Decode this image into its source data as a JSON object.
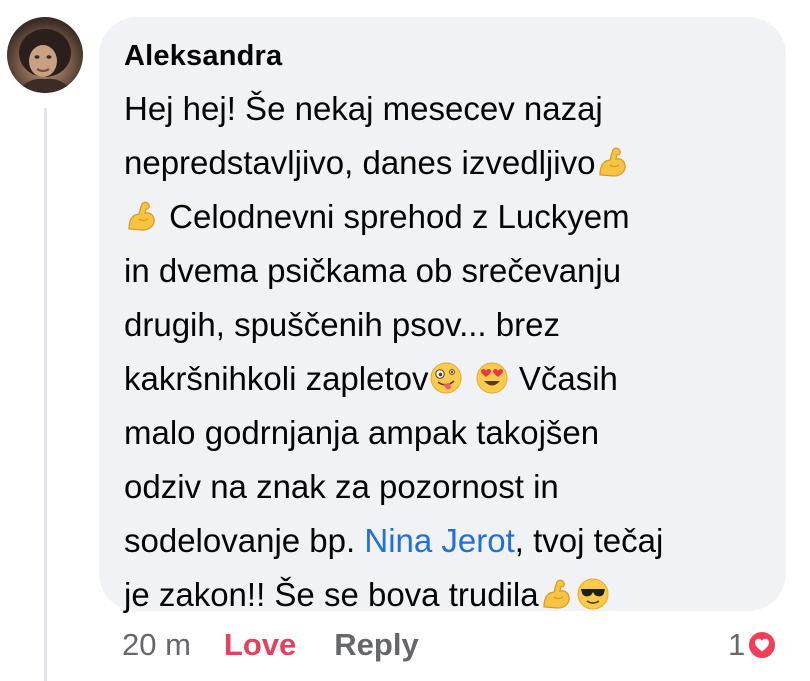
{
  "comment": {
    "author": "Aleksandra",
    "lines": [
      {
        "parts": [
          {
            "t": "Hej hej! Še nekaj mesecev nazaj"
          }
        ]
      },
      {
        "parts": [
          {
            "t": "nepredstavljivo, danes izvedljivo"
          },
          {
            "e": "flexed-biceps-icon"
          }
        ]
      },
      {
        "parts": [
          {
            "e": "flexed-biceps-icon"
          },
          {
            "t": " Celodnevni sprehod z Luckyem"
          }
        ]
      },
      {
        "parts": [
          {
            "t": "in dvema psičkama ob srečevanju"
          }
        ]
      },
      {
        "parts": [
          {
            "t": "drugih, spuščenih psov... brez"
          }
        ]
      },
      {
        "parts": [
          {
            "t": "kakršnihkoli zapletov"
          },
          {
            "e": "zany-face-icon"
          },
          {
            "t": " "
          },
          {
            "e": "heart-eyes-face-icon"
          },
          {
            "t": " Včasih"
          }
        ]
      },
      {
        "parts": [
          {
            "t": "malo godrnjanja ampak takojšen"
          }
        ]
      },
      {
        "parts": [
          {
            "t": "odziv na znak za pozornost in"
          }
        ]
      },
      {
        "parts": [
          {
            "t": "sodelovanje bp. "
          },
          {
            "m": "Nina Jerot"
          },
          {
            "t": ", tvoj tečaj"
          }
        ]
      },
      {
        "parts": [
          {
            "t": "je zakon!! Še se bova trudila"
          },
          {
            "e": "flexed-biceps-icon"
          },
          {
            "e": "sunglasses-face-icon"
          }
        ]
      }
    ]
  },
  "actions": {
    "time": "20 m",
    "love": "Love",
    "reply": "Reply"
  },
  "reactions": {
    "count": "1",
    "icon": "love-reaction-icon"
  },
  "colors": {
    "bubble": "#f0f2f5",
    "mention": "#216fdb",
    "love": "#e4405f",
    "meta": "#65676b"
  }
}
